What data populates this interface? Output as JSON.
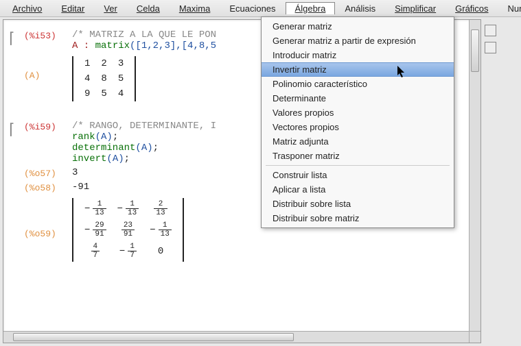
{
  "menu": {
    "archivo": "Archivo",
    "editar": "Editar",
    "ver": "Ver",
    "celda": "Celda",
    "maxima": "Maxima",
    "ecuaciones": "Ecuaciones",
    "algebra": "Álgebra",
    "analisis": "Análisis",
    "simplificar": "Simplificar",
    "graficos": "Gráficos",
    "numerico": "Numérico"
  },
  "dd": {
    "generar": "Generar matriz",
    "generar_expr": "Generar matriz a partir de expresión",
    "introducir": "Introducir matriz",
    "invertir": "Invertir matriz",
    "polinomio": "Polinomio característico",
    "determinante": "Determinante",
    "valores": "Valores propios",
    "vectores": "Vectores propios",
    "adjunta": "Matriz adjunta",
    "trasponer": "Trasponer matriz",
    "construir": "Construir lista",
    "aplicar": "Aplicar a lista",
    "dist_lista": "Distribuir sobre lista",
    "dist_matriz": "Distribuir sobre matriz"
  },
  "labels": {
    "i53": "(%i53)",
    "A": "(A)",
    "i59": "(%i59)",
    "o57": "(%o57)",
    "o58": "(%o58)",
    "o59": "(%o59)"
  },
  "code": {
    "cmt1": "/* MATRIZ A LA QUE LE PON",
    "assign": "A : ",
    "matrix_fn": "matrix",
    "matrix_args": "([1,2,3],[4,8,5",
    "m11": "1",
    "m12": "2",
    "m13": "3",
    "m21": "4",
    "m22": "8",
    "m23": "5",
    "m31": "9",
    "m32": "5",
    "m33": "4",
    "cmt2": "/* RANGO, DETERMINANTE, I",
    "rank": "rank",
    "det": "determinant",
    "inv": "invert",
    "argA": "(A)",
    "semi": ";",
    "o57v": "3",
    "o58v": "-91",
    "f11n": "1",
    "f11d": "13",
    "f12n": "1",
    "f12d": "13",
    "f13n": "2",
    "f13d": "13",
    "f21n": "29",
    "f21d": "91",
    "f22n": "23",
    "f22d": "91",
    "f23n": "1",
    "f23d": "13",
    "f31n": "4",
    "f31d": "7",
    "f32n": "1",
    "f32d": "7",
    "f33": "0"
  }
}
